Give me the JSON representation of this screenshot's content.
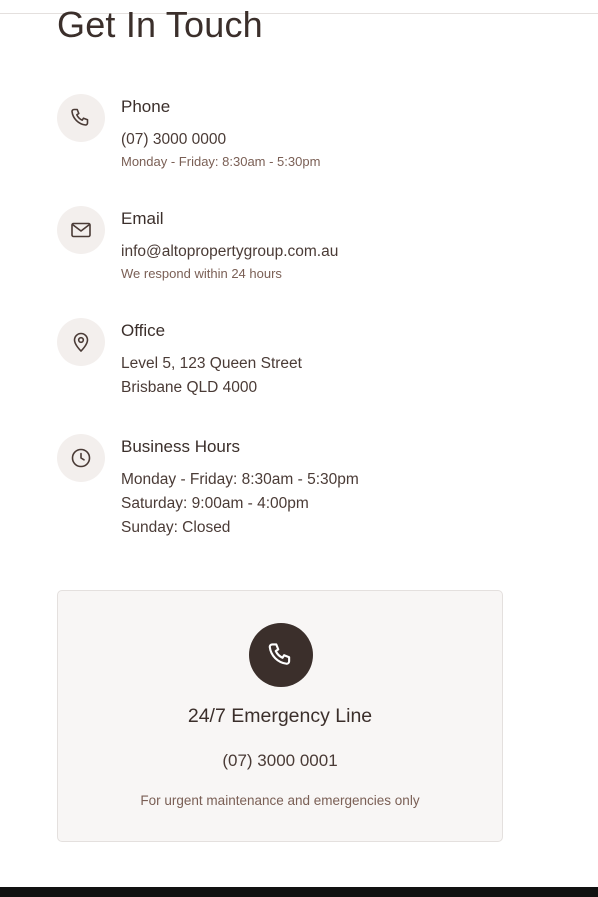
{
  "section": {
    "heading": "Get In Touch"
  },
  "contacts": [
    {
      "icon": "phone-icon",
      "title": "Phone",
      "lines": [
        "(07) 3000 0000"
      ],
      "note": "Monday - Friday: 8:30am - 5:30pm"
    },
    {
      "icon": "mail-icon",
      "title": "Email",
      "lines": [
        "info@altopropertygroup.com.au"
      ],
      "note": "We respond within 24 hours"
    },
    {
      "icon": "map-pin-icon",
      "title": "Office",
      "lines": [
        "Level 5, 123 Queen Street",
        "Brisbane QLD 4000"
      ]
    },
    {
      "icon": "clock-icon",
      "title": "Business Hours",
      "lines": [
        "Monday - Friday: 8:30am - 5:30pm",
        "Saturday: 9:00am - 4:00pm",
        "Sunday: Closed"
      ]
    }
  ],
  "emergency": {
    "icon": "phone-icon",
    "title": "24/7 Emergency Line",
    "phone": "(07) 3000 0001",
    "note": "For urgent maintenance and emergencies only"
  },
  "colors": {
    "text_primary": "#3b2f2b",
    "text_muted": "#7a5f55",
    "icon_bg": "#f3efed",
    "card_bg": "#f8f6f5",
    "accent_dark": "#3b2f2b"
  }
}
